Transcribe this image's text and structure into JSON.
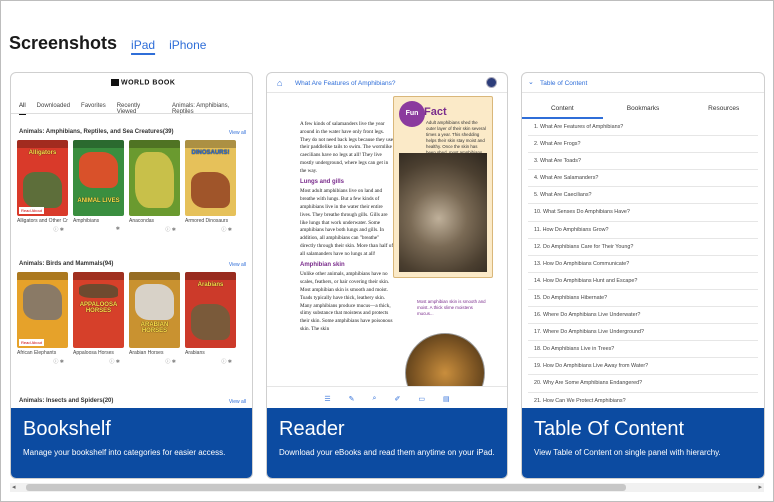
{
  "header": {
    "title": "Screenshots",
    "tabs": [
      {
        "label": "iPad",
        "active": true
      },
      {
        "label": "iPhone",
        "active": false
      }
    ]
  },
  "cards": [
    {
      "title": "Bookshelf",
      "subtitle": "Manage your bookshelf into categories for easier access."
    },
    {
      "title": "Reader",
      "subtitle": "Download your eBooks and read them anytime on your iPad."
    },
    {
      "title": "Table Of Content",
      "subtitle": "View Table of Content on single panel with hierarchy."
    }
  ],
  "bookshelf": {
    "logo": "WORLD BOOK",
    "tabs": [
      "All",
      "Downloaded",
      "Favorites",
      "Recently Viewed",
      "Animals: Amphibians, Reptiles"
    ],
    "view_all": "View all",
    "shelves": [
      {
        "heading": "Animals: Amphibians, Reptiles, and Sea Creatures(39)",
        "books": [
          {
            "name": "Alligators and Other Crocodilians",
            "cover_title": "Alligators",
            "color": "#d93a2a",
            "img": "#5d6e3a",
            "read": "Read About"
          },
          {
            "name": "Amphibians",
            "cover_title": "ANIMAL LIVES",
            "color": "#3a8e3f",
            "img": "#d9512a",
            "read": ""
          },
          {
            "name": "Anacondas",
            "cover_title": "",
            "color": "#6a9a2f",
            "img": "#c8c04a",
            "read": ""
          },
          {
            "name": "Armored Dinosaurs",
            "cover_title": "DINOSAURS!",
            "color": "#e6c15a",
            "img": "#a0552a",
            "read": ""
          }
        ]
      },
      {
        "heading": "Animals: Birds and Mammals(94)",
        "books": [
          {
            "name": "African Elephants",
            "cover_title": "",
            "color": "#e6a22a",
            "img": "#8a7a66",
            "read": "Read About"
          },
          {
            "name": "Appaloosa Horses",
            "cover_title": "APPALOOSA HORSES",
            "color": "#d6402a",
            "img": "#6e4a2f",
            "read": ""
          },
          {
            "name": "Arabian Horses",
            "cover_title": "ARABIAN HORSES",
            "color": "#c99230",
            "img": "#d8d2c8",
            "read": ""
          },
          {
            "name": "Arabians",
            "cover_title": "Arabians",
            "color": "#cc3a2a",
            "img": "#7a5a3a",
            "read": ""
          }
        ]
      }
    ],
    "bottom_heading": "Animals: Insects and Spiders(20)"
  },
  "reader": {
    "title": "What Are Features of Amphibians?",
    "para1": "A few kinds of salamanders live the year around in the water have only front legs. They do not need back legs because they use their paddlelike tails to swim. The wormlike caecilians have no legs at all! They live mostly underground, where legs can get in the way.",
    "heading1": "Lungs and gills",
    "para2": "Most adult amphibians live on land and breathe with lungs. But a few kinds of amphibians live in the water their entire lives. They breathe through gills. Gills are like lungs that work underwater. Some amphibians have both lungs and gills. In addition, all amphibians can \"breathe\" directly through their skin. More than half of all salamanders have no lungs at all!",
    "heading2": "Amphibian skin",
    "para3": "Unlike other animals, amphibians have no scales, feathers, or hair covering their skin. Most amphibian skin is smooth and moist. Toads typically have thick, leathery skin. Many amphibians produce mucus—a thick, slimy substance that moistens and protects their skin. Some amphibians have poisonous skin. The skin",
    "fun_badge": "Fun",
    "fun_word": "Fact",
    "fun_text": "Adult amphibians shed the outer layer of their skin several times a year. This shedding helps their skin stay moist and healthy. Once the skin has been shed, most amphibians eat it!",
    "side_note": "Most amphibian skin is smooth and moist. A thick slime moistens mucus..."
  },
  "toc": {
    "title": "Table of Content",
    "tabs": [
      "Content",
      "Bookmarks",
      "Resources"
    ],
    "items": [
      "1. What Are Features of Amphibians?",
      "2. What Are Frogs?",
      "3. What Are Toads?",
      "4. What Are Salamanders?",
      "5. What Are Caecilians?",
      "10. What Senses Do Amphibians Have?",
      "11. How Do Amphibians Grow?",
      "12. Do Amphibians Care for Their Young?",
      "13. How Do Amphibians Communicate?",
      "14. How Do Amphibians Hunt and Escape?",
      "15. Do Amphibians Hibernate?",
      "16. Where Do Amphibians Live Underwater?",
      "17. Where Do Amphibians Live Underground?",
      "18. Do Amphibians Live in Trees?",
      "19. How Do Amphibians Live Away from Water?",
      "20. Why Are Some Amphibians Endangered?",
      "21. How Can We Protect Amphibians?"
    ]
  }
}
